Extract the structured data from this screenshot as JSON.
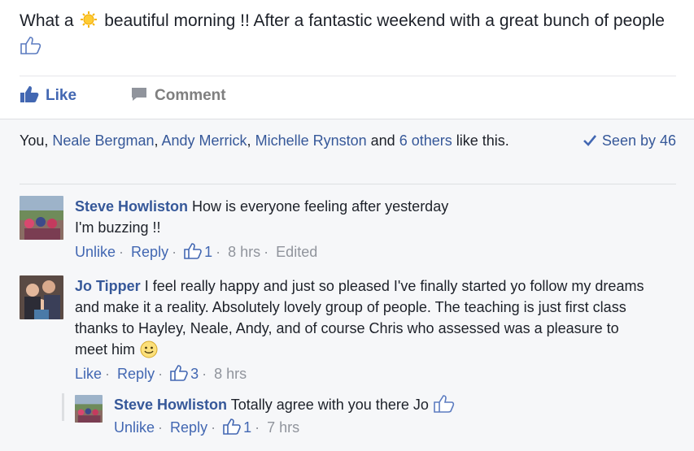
{
  "post": {
    "text_before": "What a",
    "text_after": "beautiful morning !! After a fantastic weekend with a great bunch of people"
  },
  "actions": {
    "like": "Like",
    "comment": "Comment"
  },
  "likes": {
    "you": "You,",
    "names": [
      "Neale Bergman",
      "Andy Merrick",
      "Michelle Rynston"
    ],
    "sep": ",",
    "and": "and",
    "others": "6 others",
    "suffix": "like this.",
    "seen": "Seen by 46"
  },
  "comments": [
    {
      "author": "Steve Howliston",
      "text": "How is everyone feeling after yesterday",
      "text2": "I'm buzzing !!",
      "action": "Unlike",
      "reply": "Reply",
      "likes": "1",
      "time": "8 hrs",
      "edited": "Edited"
    },
    {
      "author": "Jo Tipper",
      "text": "I feel really happy and just so pleased I've finally started yo follow my dreams and make it a reality. Absolutely lovely group of people. The teaching is just first class thanks to Hayley, Neale, Andy, and of course Chris who assessed was a pleasure to meet him",
      "action": "Like",
      "reply": "Reply",
      "likes": "3",
      "time": "8 hrs"
    }
  ],
  "reply": {
    "author": "Steve Howliston",
    "text": "Totally agree with you there Jo",
    "action": "Unlike",
    "reply": "Reply",
    "likes": "1",
    "time": "7 hrs"
  },
  "colors": {
    "link": "#365899",
    "accent": "#4267b2",
    "muted": "#90949c",
    "background": "#f6f7f9"
  }
}
